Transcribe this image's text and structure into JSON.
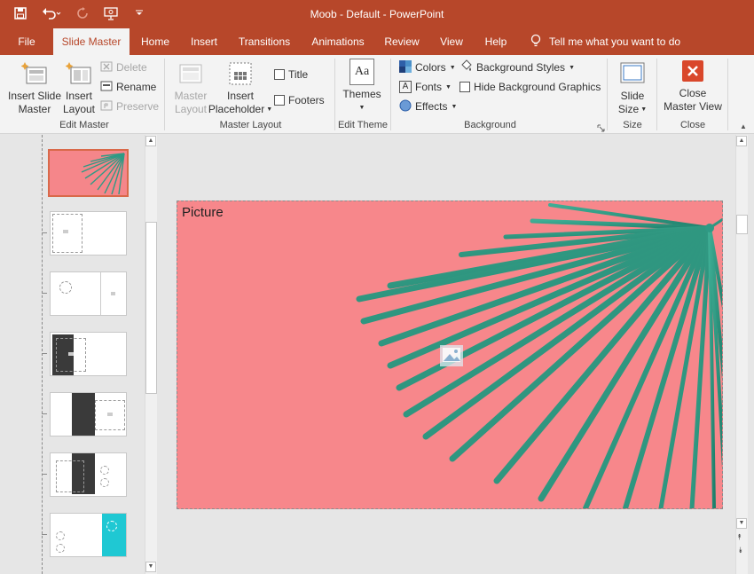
{
  "window": {
    "title": "Moob - Default  -  PowerPoint"
  },
  "qat": {
    "icons": [
      "save-icon",
      "undo-icon",
      "redo-icon",
      "present-icon",
      "customize-icon"
    ]
  },
  "tabs": [
    "File",
    "Slide Master",
    "Home",
    "Insert",
    "Transitions",
    "Animations",
    "Review",
    "View",
    "Help"
  ],
  "active_tab": "Slide Master",
  "tell_me": "Tell me what you want to do",
  "ribbon": {
    "edit_master": {
      "label": "Edit Master",
      "insert_slide_master": [
        "Insert Slide",
        "Master"
      ],
      "insert_layout": [
        "Insert",
        "Layout"
      ],
      "delete": "Delete",
      "rename": "Rename",
      "preserve": "Preserve"
    },
    "master_layout": {
      "label": "Master Layout",
      "master_layout_btn": [
        "Master",
        "Layout"
      ],
      "insert_placeholder": [
        "Insert",
        "Placeholder"
      ],
      "title": "Title",
      "footers": "Footers"
    },
    "edit_theme": {
      "label": "Edit Theme",
      "themes": "Themes",
      "themes_glyph": "Aa"
    },
    "background": {
      "label": "Background",
      "colors": "Colors",
      "fonts": "Fonts",
      "effects": "Effects",
      "background_styles": "Background Styles",
      "hide_background_graphics": "Hide Background Graphics"
    },
    "size": {
      "label": "Size",
      "slide_size": [
        "Slide",
        "Size"
      ]
    },
    "close": {
      "label": "Close",
      "close_master_view": [
        "Close",
        "Master View"
      ]
    }
  },
  "slide": {
    "placeholder_label": "Picture"
  },
  "colors": {
    "brand": "#b7472a",
    "slide_bg": "#f7878b",
    "leaf": "#2f9a85",
    "close_red": "#d9472b"
  }
}
